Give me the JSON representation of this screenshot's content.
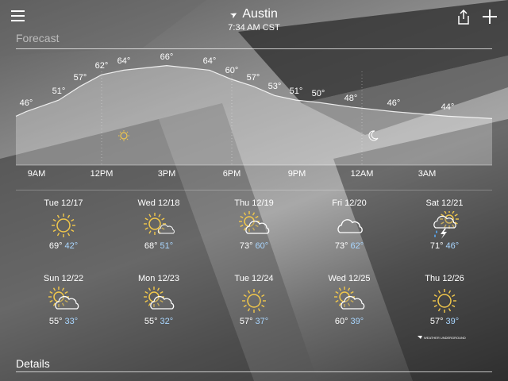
{
  "header": {
    "location": "Austin",
    "time": "7:34 AM CST"
  },
  "forecast": {
    "title": "Forecast",
    "hourly_temps": [
      "46°",
      "51°",
      "57°",
      "62°",
      "64°",
      "66°",
      "64°",
      "60°",
      "57°",
      "53°",
      "51°",
      "50°",
      "48°",
      "46°",
      "44°"
    ],
    "hour_labels": [
      "9AM",
      "12PM",
      "3PM",
      "6PM",
      "9PM",
      "12AM",
      "3AM"
    ]
  },
  "days": [
    {
      "date": "Tue 12/17",
      "hi": "69°",
      "lo": "42°",
      "icon": "sun-icon"
    },
    {
      "date": "Wed 12/18",
      "hi": "68°",
      "lo": "51°",
      "icon": "partly-cloudy-icon"
    },
    {
      "date": "Thu 12/19",
      "hi": "73°",
      "lo": "60°",
      "icon": "mostly-cloudy-icon"
    },
    {
      "date": "Fri 12/20",
      "hi": "73°",
      "lo": "62°",
      "icon": "cloud-icon"
    },
    {
      "date": "Sat 12/21",
      "hi": "71°",
      "lo": "46°",
      "icon": "thunderstorm-icon"
    },
    {
      "date": "Sun 12/22",
      "hi": "55°",
      "lo": "33°",
      "icon": "mostly-cloudy-icon"
    },
    {
      "date": "Mon 12/23",
      "hi": "55°",
      "lo": "32°",
      "icon": "mostly-cloudy-icon"
    },
    {
      "date": "Tue 12/24",
      "hi": "57°",
      "lo": "37°",
      "icon": "sun-icon"
    },
    {
      "date": "Wed 12/25",
      "hi": "60°",
      "lo": "39°",
      "icon": "mostly-cloudy-icon"
    },
    {
      "date": "Thu 12/26",
      "hi": "57°",
      "lo": "39°",
      "icon": "sun-icon"
    }
  ],
  "footer": {
    "details_label": "Details",
    "attribution": "WEATHER UNDERGROUND"
  },
  "colors": {
    "sun": "#f2c84b",
    "low_temp": "#a9d6ff",
    "rain": "#5aa7f0"
  }
}
